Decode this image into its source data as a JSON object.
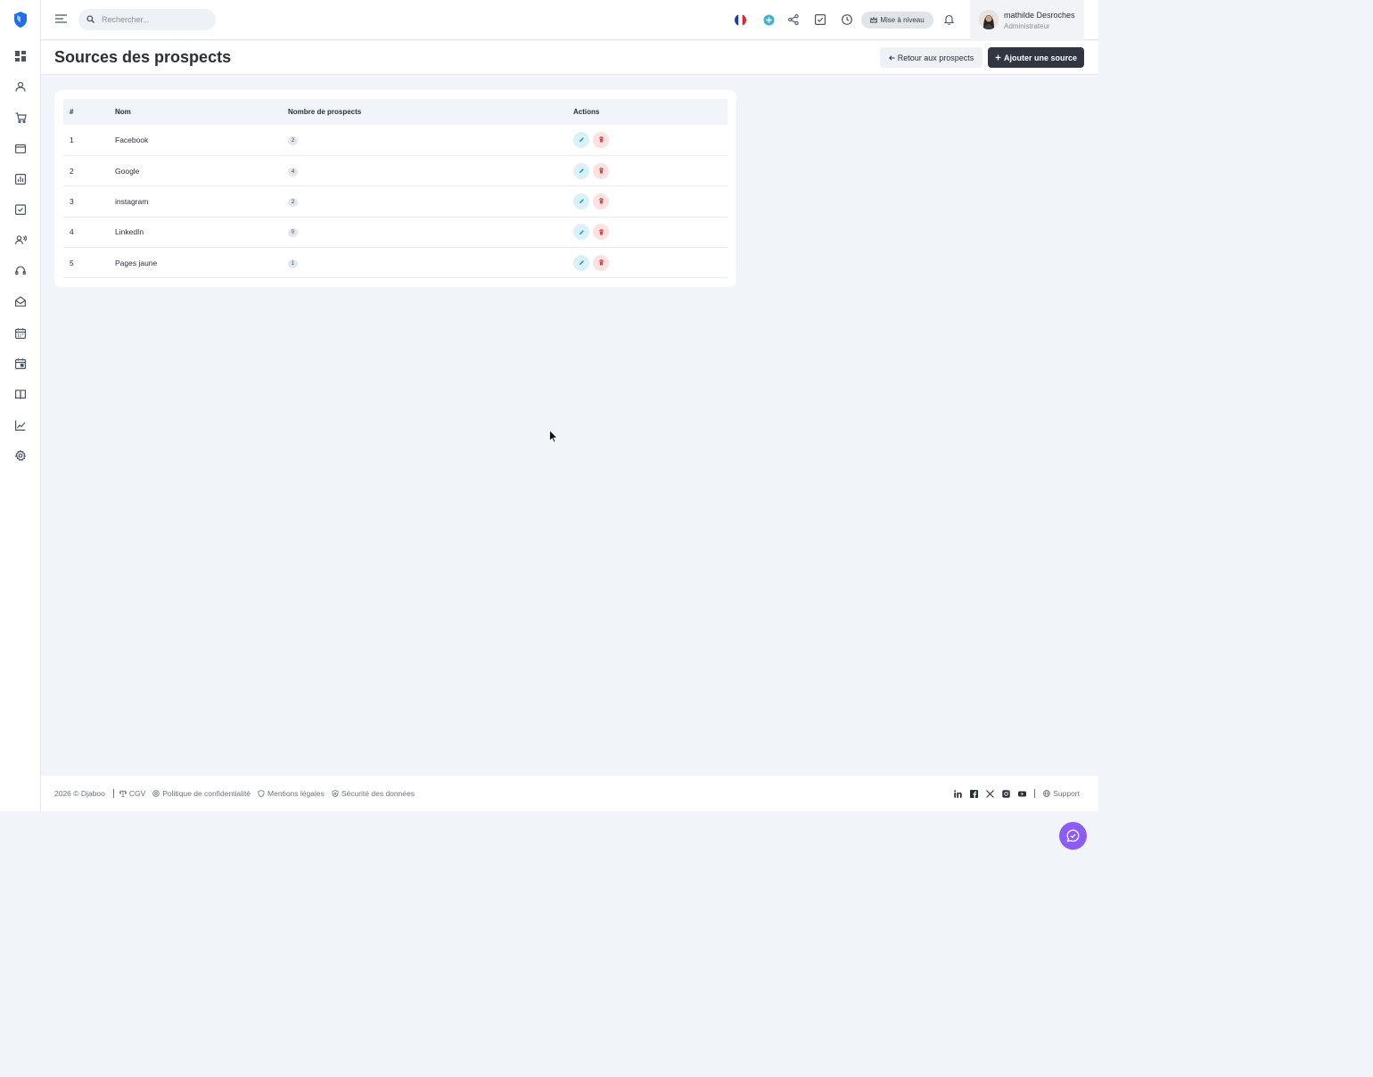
{
  "search": {
    "placeholder": "Rechercher..."
  },
  "topbar": {
    "upgrade_label": "Mise à niveau"
  },
  "user": {
    "name": "mathilde Desroches",
    "role": "Administrateur"
  },
  "page": {
    "title": "Sources des prospects",
    "back_label": "Retour aux prospects",
    "add_label": "Ajouter une source"
  },
  "table": {
    "headers": {
      "num": "#",
      "name": "Nom",
      "count": "Nombre de prospects",
      "actions": "Actions"
    },
    "rows": [
      {
        "num": "1",
        "name": "Facebook",
        "count": "2"
      },
      {
        "num": "2",
        "name": "Google",
        "count": "4"
      },
      {
        "num": "3",
        "name": "instagram",
        "count": "2"
      },
      {
        "num": "4",
        "name": "LinkedIn",
        "count": "0"
      },
      {
        "num": "5",
        "name": "Pages jaune",
        "count": "1"
      }
    ]
  },
  "footer": {
    "copyright": "2026 © Djaboo",
    "links": {
      "cgv": "CGV",
      "privacy": "Politique de confidentialité",
      "legal": "Mentions légales",
      "security": "Sécurité des données"
    },
    "support": "Support"
  },
  "colors": {
    "accent": "#303642",
    "brand": "#1f6feb",
    "edit": "#0ea5c6",
    "delete": "#e04848",
    "chat": "#8b5cf6"
  },
  "icons": {
    "sidebar": [
      "dashboard-icon",
      "user-icon",
      "cart-icon",
      "wallet-icon",
      "bar-chart-icon",
      "clipboard-check-icon",
      "team-icon",
      "headset-icon",
      "mail-open-icon",
      "calendar-icon",
      "calendar-event-icon",
      "book-icon",
      "line-chart-icon",
      "gear-icon"
    ]
  }
}
